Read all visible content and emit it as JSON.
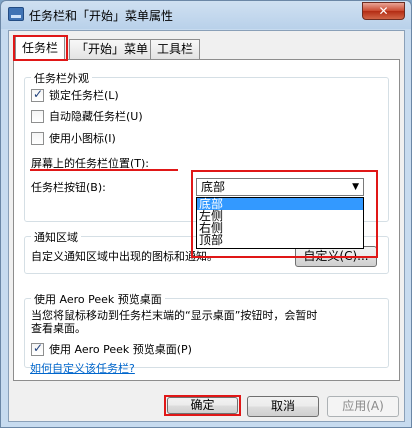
{
  "window": {
    "title": "任务栏和「开始」菜单属性",
    "close_label": "✕"
  },
  "tabs": [
    {
      "label": "任务栏",
      "active": true
    },
    {
      "label": "「开始」菜单",
      "active": false
    },
    {
      "label": "工具栏",
      "active": false
    }
  ],
  "appearance": {
    "title": "任务栏外观",
    "options": [
      {
        "label": "锁定任务栏(L)",
        "checked": true
      },
      {
        "label": "自动隐藏任务栏(U)",
        "checked": false
      },
      {
        "label": "使用小图标(I)",
        "checked": false
      }
    ],
    "position_label": "屏幕上的任务栏位置(T):",
    "position_value": "底部",
    "position_options": [
      "底部",
      "左侧",
      "右侧",
      "顶部"
    ],
    "buttons_label": "任务栏按钮(B):"
  },
  "notification": {
    "title": "通知区域",
    "description": "自定义通知区域中出现的图标和通知。",
    "customize_label": "自定义(C)..."
  },
  "aero_peek": {
    "title": "使用 Aero Peek 预览桌面",
    "description_line1": "当您将鼠标移动到任务栏末端的“显示桌面”按钮时，会暂时",
    "description_line2": "查看桌面。",
    "option_label": "使用 Aero Peek 预览桌面(P)",
    "option_checked": true
  },
  "help_link": "如何自定义该任务栏?",
  "footer": {
    "ok_label": "确定",
    "cancel_label": "取消",
    "apply_label": "应用(A)"
  },
  "colors": {
    "highlight_red": "#e01717",
    "selection_blue": "#3399ff",
    "link_blue": "#0066cc"
  }
}
